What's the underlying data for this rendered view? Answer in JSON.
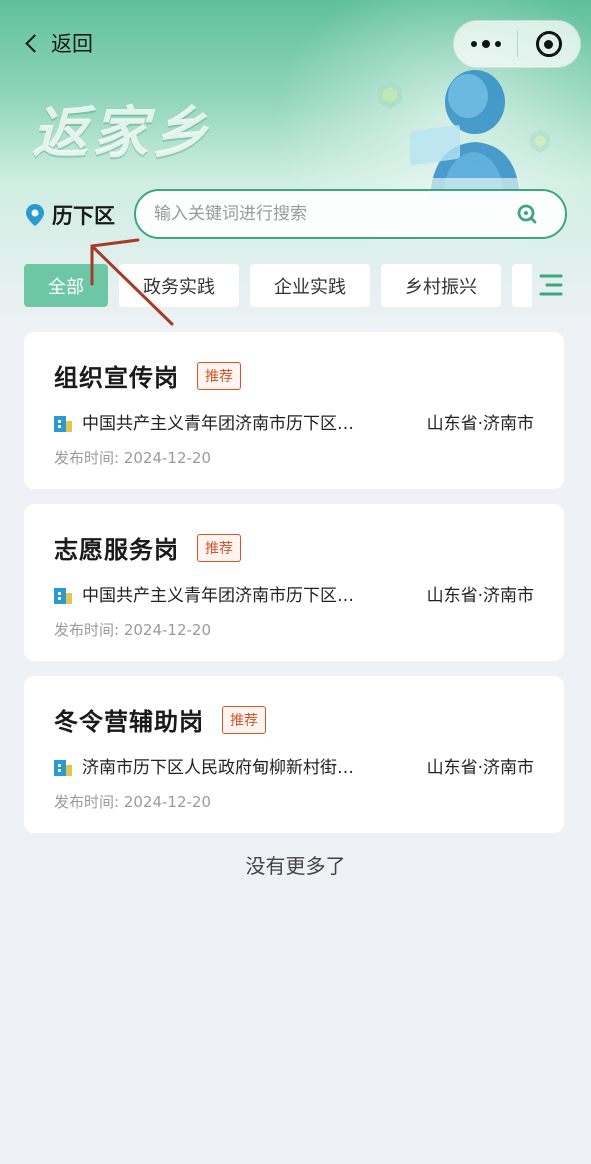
{
  "nav": {
    "back_label": "返回"
  },
  "brand": {
    "title": "返家乡"
  },
  "location": {
    "district": "历下区"
  },
  "search": {
    "placeholder": "输入关键词进行搜索"
  },
  "tabs": [
    {
      "label": "全部",
      "active": true
    },
    {
      "label": "政务实践",
      "active": false
    },
    {
      "label": "企业实践",
      "active": false
    },
    {
      "label": "乡村振兴",
      "active": false
    }
  ],
  "jobs": [
    {
      "title": "组织宣传岗",
      "tag": "推荐",
      "org": "中国共产主义青年团济南市历下区…",
      "city": "山东省·济南市",
      "date": "发布时间: 2024-12-20"
    },
    {
      "title": "志愿服务岗",
      "tag": "推荐",
      "org": "中国共产主义青年团济南市历下区…",
      "city": "山东省·济南市",
      "date": "发布时间: 2024-12-20"
    },
    {
      "title": "冬令营辅助岗",
      "tag": "推荐",
      "org": "济南市历下区人民政府甸柳新村街…",
      "city": "山东省·济南市",
      "date": "发布时间: 2024-12-20"
    }
  ],
  "footer": {
    "no_more": "没有更多了"
  },
  "colors": {
    "accent": "#3aa77f",
    "tab_active": "#6dc7a4",
    "tag": "#d4542b",
    "annotation_arrow": "#a83a2a"
  },
  "icons": [
    "back-chevron-icon",
    "more-dots-icon",
    "close-target-icon",
    "location-pin-icon",
    "search-icon",
    "filter-menu-icon",
    "building-icon"
  ]
}
